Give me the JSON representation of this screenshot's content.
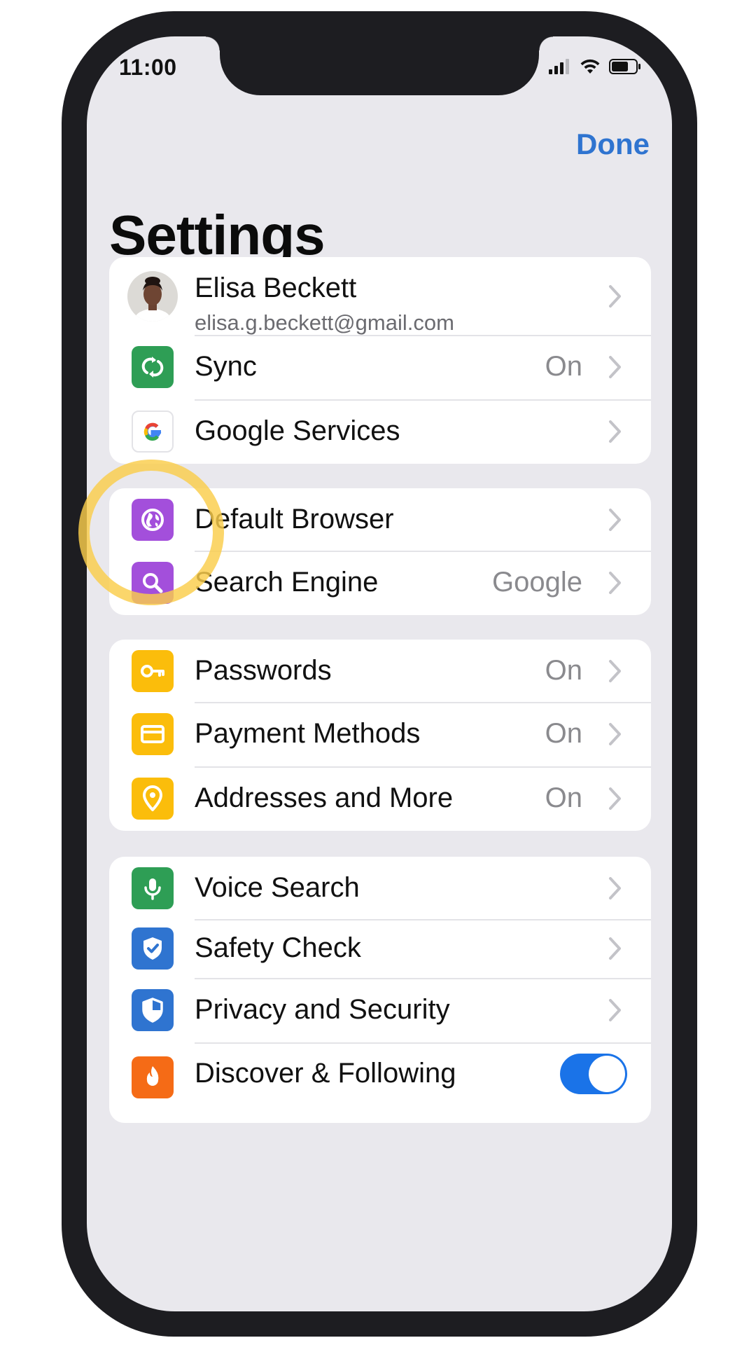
{
  "status": {
    "time": "11:00"
  },
  "nav": {
    "done_label": "Done"
  },
  "page": {
    "title": "Settings"
  },
  "colors": {
    "accent": "#2f74d0",
    "sync": "#2e9e55",
    "default_browser": "#a34fdb",
    "search_engine": "#a34fdb",
    "autofill": "#fbbd0b",
    "voice": "#2e9e55",
    "safety": "#2f74d0",
    "discover": "#f56b16",
    "highlight": "#facd4b"
  },
  "profile": {
    "name": "Elisa Beckett",
    "email": "elisa.g.beckett@gmail.com"
  },
  "group1": {
    "sync": {
      "label": "Sync",
      "value": "On",
      "icon": "sync-icon"
    },
    "google_services": {
      "label": "Google Services",
      "icon": "google-g-icon"
    }
  },
  "group2": {
    "default_browser": {
      "label": "Default Browser",
      "icon": "globe-icon"
    },
    "search_engine": {
      "label": "Search Engine",
      "value": "Google",
      "icon": "search-icon"
    }
  },
  "group3": {
    "passwords": {
      "label": "Passwords",
      "value": "On",
      "icon": "key-icon"
    },
    "payment_methods": {
      "label": "Payment Methods",
      "value": "On",
      "icon": "credit-card-icon"
    },
    "addresses": {
      "label": "Addresses and More",
      "value": "On",
      "icon": "location-pin-icon"
    }
  },
  "group4": {
    "voice_search": {
      "label": "Voice Search",
      "icon": "microphone-icon"
    },
    "safety_check": {
      "label": "Safety Check",
      "icon": "shield-check-icon"
    },
    "privacy": {
      "label": "Privacy and Security",
      "icon": "shield-icon"
    },
    "discover": {
      "label": "Discover & Following",
      "icon": "flame-icon",
      "toggle_on": true
    }
  }
}
